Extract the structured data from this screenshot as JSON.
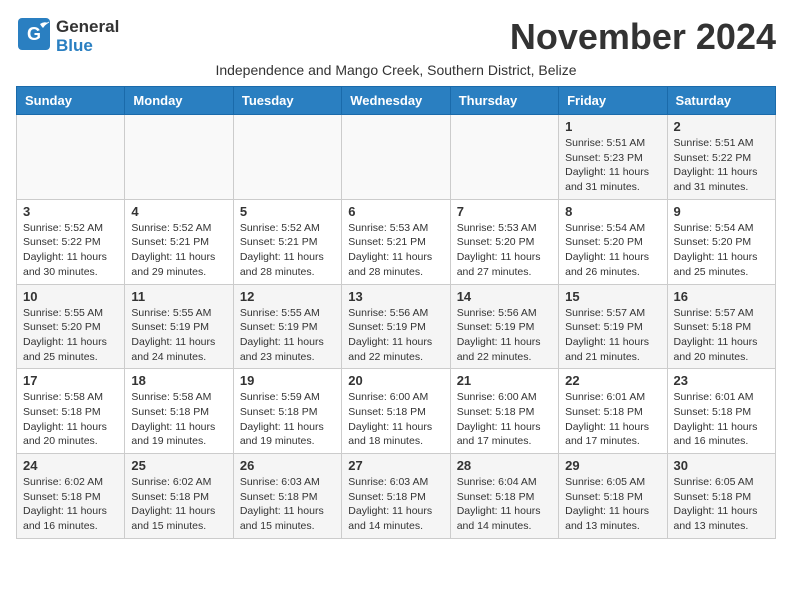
{
  "header": {
    "logo_general": "General",
    "logo_blue": "Blue",
    "month_title": "November 2024",
    "subtitle": "Independence and Mango Creek, Southern District, Belize"
  },
  "weekdays": [
    "Sunday",
    "Monday",
    "Tuesday",
    "Wednesday",
    "Thursday",
    "Friday",
    "Saturday"
  ],
  "weeks": [
    [
      {
        "day": "",
        "info": ""
      },
      {
        "day": "",
        "info": ""
      },
      {
        "day": "",
        "info": ""
      },
      {
        "day": "",
        "info": ""
      },
      {
        "day": "",
        "info": ""
      },
      {
        "day": "1",
        "info": "Sunrise: 5:51 AM\nSunset: 5:23 PM\nDaylight: 11 hours and 31 minutes."
      },
      {
        "day": "2",
        "info": "Sunrise: 5:51 AM\nSunset: 5:22 PM\nDaylight: 11 hours and 31 minutes."
      }
    ],
    [
      {
        "day": "3",
        "info": "Sunrise: 5:52 AM\nSunset: 5:22 PM\nDaylight: 11 hours and 30 minutes."
      },
      {
        "day": "4",
        "info": "Sunrise: 5:52 AM\nSunset: 5:21 PM\nDaylight: 11 hours and 29 minutes."
      },
      {
        "day": "5",
        "info": "Sunrise: 5:52 AM\nSunset: 5:21 PM\nDaylight: 11 hours and 28 minutes."
      },
      {
        "day": "6",
        "info": "Sunrise: 5:53 AM\nSunset: 5:21 PM\nDaylight: 11 hours and 28 minutes."
      },
      {
        "day": "7",
        "info": "Sunrise: 5:53 AM\nSunset: 5:20 PM\nDaylight: 11 hours and 27 minutes."
      },
      {
        "day": "8",
        "info": "Sunrise: 5:54 AM\nSunset: 5:20 PM\nDaylight: 11 hours and 26 minutes."
      },
      {
        "day": "9",
        "info": "Sunrise: 5:54 AM\nSunset: 5:20 PM\nDaylight: 11 hours and 25 minutes."
      }
    ],
    [
      {
        "day": "10",
        "info": "Sunrise: 5:55 AM\nSunset: 5:20 PM\nDaylight: 11 hours and 25 minutes."
      },
      {
        "day": "11",
        "info": "Sunrise: 5:55 AM\nSunset: 5:19 PM\nDaylight: 11 hours and 24 minutes."
      },
      {
        "day": "12",
        "info": "Sunrise: 5:55 AM\nSunset: 5:19 PM\nDaylight: 11 hours and 23 minutes."
      },
      {
        "day": "13",
        "info": "Sunrise: 5:56 AM\nSunset: 5:19 PM\nDaylight: 11 hours and 22 minutes."
      },
      {
        "day": "14",
        "info": "Sunrise: 5:56 AM\nSunset: 5:19 PM\nDaylight: 11 hours and 22 minutes."
      },
      {
        "day": "15",
        "info": "Sunrise: 5:57 AM\nSunset: 5:19 PM\nDaylight: 11 hours and 21 minutes."
      },
      {
        "day": "16",
        "info": "Sunrise: 5:57 AM\nSunset: 5:18 PM\nDaylight: 11 hours and 20 minutes."
      }
    ],
    [
      {
        "day": "17",
        "info": "Sunrise: 5:58 AM\nSunset: 5:18 PM\nDaylight: 11 hours and 20 minutes."
      },
      {
        "day": "18",
        "info": "Sunrise: 5:58 AM\nSunset: 5:18 PM\nDaylight: 11 hours and 19 minutes."
      },
      {
        "day": "19",
        "info": "Sunrise: 5:59 AM\nSunset: 5:18 PM\nDaylight: 11 hours and 19 minutes."
      },
      {
        "day": "20",
        "info": "Sunrise: 6:00 AM\nSunset: 5:18 PM\nDaylight: 11 hours and 18 minutes."
      },
      {
        "day": "21",
        "info": "Sunrise: 6:00 AM\nSunset: 5:18 PM\nDaylight: 11 hours and 17 minutes."
      },
      {
        "day": "22",
        "info": "Sunrise: 6:01 AM\nSunset: 5:18 PM\nDaylight: 11 hours and 17 minutes."
      },
      {
        "day": "23",
        "info": "Sunrise: 6:01 AM\nSunset: 5:18 PM\nDaylight: 11 hours and 16 minutes."
      }
    ],
    [
      {
        "day": "24",
        "info": "Sunrise: 6:02 AM\nSunset: 5:18 PM\nDaylight: 11 hours and 16 minutes."
      },
      {
        "day": "25",
        "info": "Sunrise: 6:02 AM\nSunset: 5:18 PM\nDaylight: 11 hours and 15 minutes."
      },
      {
        "day": "26",
        "info": "Sunrise: 6:03 AM\nSunset: 5:18 PM\nDaylight: 11 hours and 15 minutes."
      },
      {
        "day": "27",
        "info": "Sunrise: 6:03 AM\nSunset: 5:18 PM\nDaylight: 11 hours and 14 minutes."
      },
      {
        "day": "28",
        "info": "Sunrise: 6:04 AM\nSunset: 5:18 PM\nDaylight: 11 hours and 14 minutes."
      },
      {
        "day": "29",
        "info": "Sunrise: 6:05 AM\nSunset: 5:18 PM\nDaylight: 11 hours and 13 minutes."
      },
      {
        "day": "30",
        "info": "Sunrise: 6:05 AM\nSunset: 5:18 PM\nDaylight: 11 hours and 13 minutes."
      }
    ]
  ]
}
